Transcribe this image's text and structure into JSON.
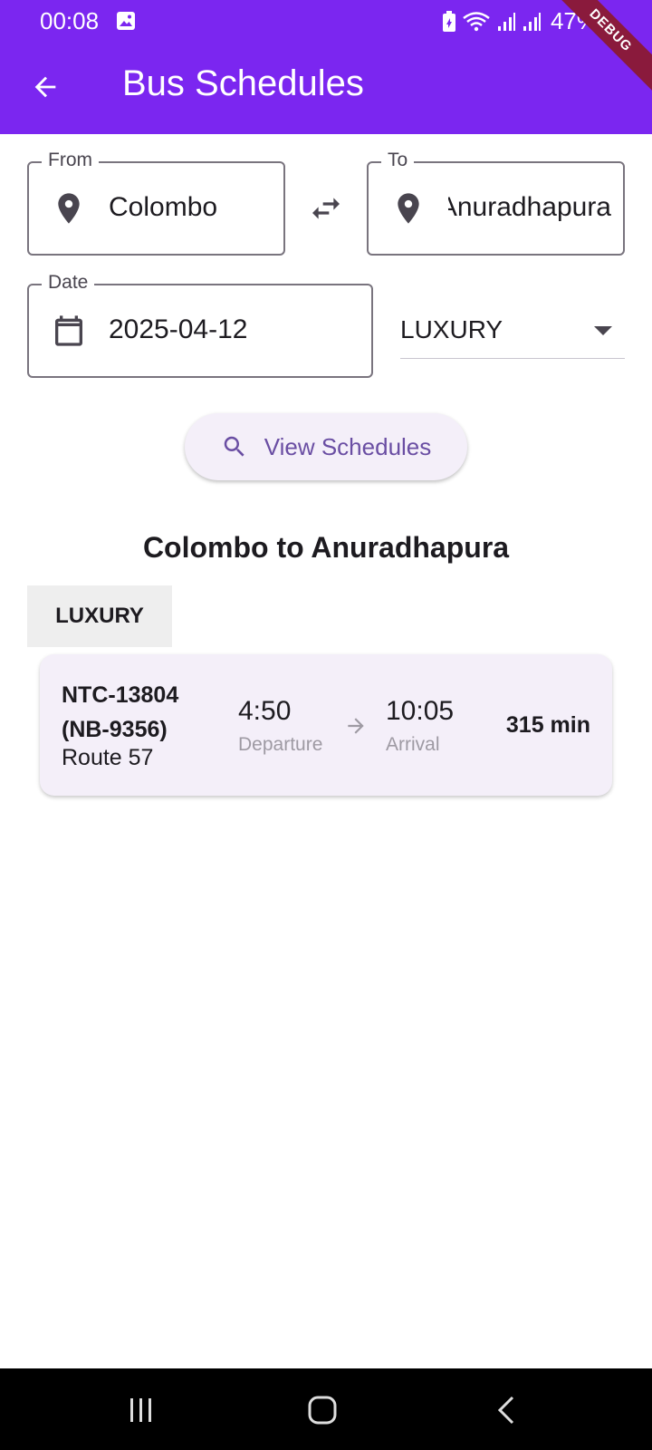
{
  "status_bar": {
    "time": "00:08",
    "battery": "47%"
  },
  "app_bar": {
    "title": "Bus Schedules",
    "debug_banner": "DEBUG",
    "color": "#7b26f0"
  },
  "search": {
    "from_label": "From",
    "from_value": "Colombo",
    "to_label": "To",
    "to_value": "Anuradhapura",
    "date_label": "Date",
    "date_value": "2025-04-12",
    "bus_class": "LUXURY",
    "view_button": "View Schedules"
  },
  "results": {
    "heading": "Colombo to Anuradhapura",
    "groups": [
      {
        "class": "LUXURY",
        "schedules": [
          {
            "bus_id": "NTC-13804 (NB-9356)",
            "route": "Route 57",
            "departure_time": "4:50",
            "departure_label": "Departure",
            "arrival_time": "10:05",
            "arrival_label": "Arrival",
            "duration": "315 min"
          }
        ]
      }
    ]
  },
  "icons": {
    "back": "arrow-back-icon",
    "location": "location-pin-icon",
    "swap": "swap-horiz-icon",
    "calendar": "calendar-icon",
    "search": "search-icon",
    "arrow": "arrow-forward-icon"
  }
}
